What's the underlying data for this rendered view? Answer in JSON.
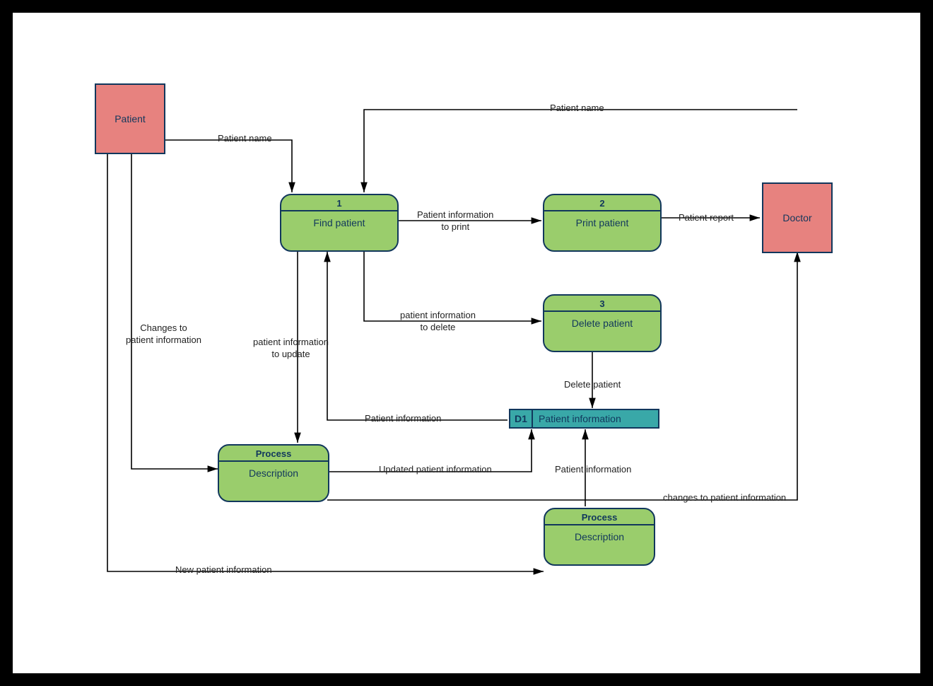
{
  "entities": {
    "patient": "Patient",
    "doctor": "Doctor"
  },
  "processes": {
    "p1": {
      "num": "1",
      "label": "Find patient"
    },
    "p2": {
      "num": "2",
      "label": "Print patient"
    },
    "p3": {
      "num": "3",
      "label": "Delete patient"
    },
    "pA": {
      "num": "Process",
      "label": "Description"
    },
    "pB": {
      "num": "Process",
      "label": "Description"
    }
  },
  "datastores": {
    "d1": {
      "id": "D1",
      "label": "Patient information"
    }
  },
  "flows": {
    "f_patient_to_find": "Patient name",
    "f_doctor_to_find": "Patient name",
    "f_find_to_print": "Patient information\nto print",
    "f_print_to_doctor": "Patient report",
    "f_find_to_delete": "patient information\nto delete",
    "f_delete_to_ds": "Delete patient",
    "f_ds_to_find": "Patient information",
    "f_find_to_pA": "patient information\nto update",
    "f_patient_to_pA": "Changes to\npatient information",
    "f_pA_to_ds": "Updated patient information",
    "f_ds_to_pB": "Patient information",
    "f_pA_to_doctor": "changes to patient information",
    "f_patient_to_pB": "New patient information"
  }
}
